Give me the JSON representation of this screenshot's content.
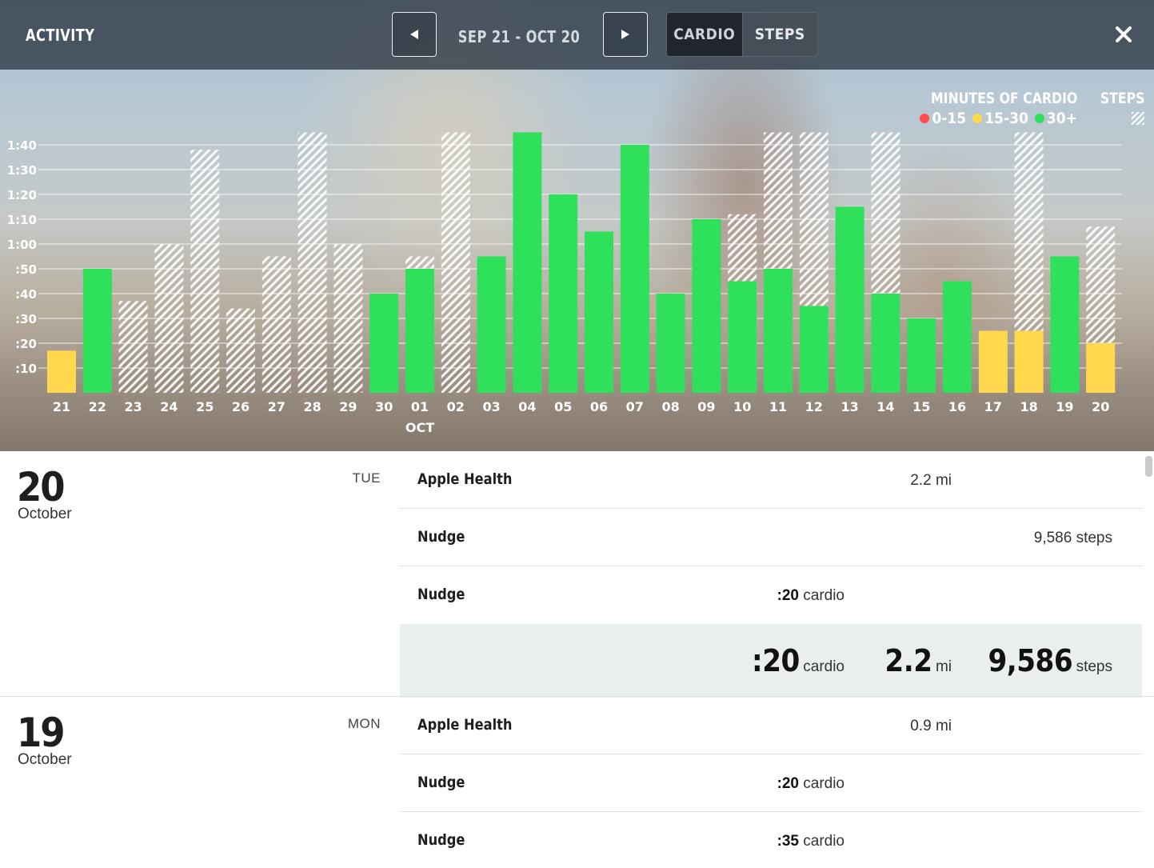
{
  "header": {
    "title": "ACTIVITY",
    "date_range": "SEP 21 - OCT 20",
    "tabs": [
      {
        "label": "CARDIO",
        "active": true
      },
      {
        "label": "STEPS",
        "active": false
      }
    ]
  },
  "legend": {
    "cardio_title": "MINUTES OF CARDIO",
    "steps_title": "STEPS",
    "ranges": [
      {
        "label": "0-15",
        "color": "#ff4d4d"
      },
      {
        "label": "15-30",
        "color": "#ffd84d"
      },
      {
        "label": "30+",
        "color": "#2ee05a"
      }
    ]
  },
  "chart_data": {
    "type": "bar",
    "y_ticks": [
      ":10",
      ":20",
      ":30",
      ":40",
      ":50",
      "1:00",
      "1:10",
      "1:20",
      "1:30",
      "1:40"
    ],
    "ylim": [
      0,
      105
    ],
    "y_unit": "minutes",
    "month_label": "OCT",
    "categories": [
      "21",
      "22",
      "23",
      "24",
      "25",
      "26",
      "27",
      "28",
      "29",
      "30",
      "01",
      "02",
      "03",
      "04",
      "05",
      "06",
      "07",
      "08",
      "09",
      "10",
      "11",
      "12",
      "13",
      "14",
      "15",
      "16",
      "17",
      "18",
      "19",
      "20"
    ],
    "series": [
      {
        "name": "MINUTES OF CARDIO",
        "values": [
          17,
          50,
          0,
          0,
          0,
          0,
          0,
          0,
          0,
          40,
          50,
          0,
          55,
          105,
          80,
          65,
          100,
          40,
          70,
          45,
          50,
          35,
          75,
          40,
          30,
          45,
          25,
          25,
          55,
          20
        ]
      },
      {
        "name": "STEPS",
        "values": [
          0,
          0,
          37,
          60,
          98,
          34,
          55,
          105,
          60,
          0,
          55,
          105,
          0,
          0,
          0,
          0,
          0,
          0,
          0,
          72,
          105,
          105,
          0,
          105,
          0,
          0,
          0,
          105,
          0,
          67
        ]
      }
    ],
    "colors": {
      "low": "#ff4d4d",
      "mid": "#ffd84d",
      "high": "#2ee05a"
    }
  },
  "days": [
    {
      "day": "20",
      "month": "October",
      "weekday": "TUE",
      "entries": [
        {
          "source": "Apple Health",
          "distance": "2.2",
          "distance_unit": "mi"
        },
        {
          "source": "Nudge",
          "steps": "9,586",
          "steps_unit": "steps"
        },
        {
          "source": "Nudge",
          "cardio": ":20",
          "cardio_unit": "cardio"
        }
      ],
      "summary": {
        "cardio": ":20",
        "cardio_unit": "cardio",
        "distance": "2.2",
        "distance_unit": "mi",
        "steps": "9,586",
        "steps_unit": "steps"
      }
    },
    {
      "day": "19",
      "month": "October",
      "weekday": "MON",
      "entries": [
        {
          "source": "Apple Health",
          "distance": "0.9",
          "distance_unit": "mi"
        },
        {
          "source": "Nudge",
          "cardio": ":20",
          "cardio_unit": "cardio"
        },
        {
          "source": "Nudge",
          "cardio": ":35",
          "cardio_unit": "cardio"
        }
      ]
    }
  ]
}
